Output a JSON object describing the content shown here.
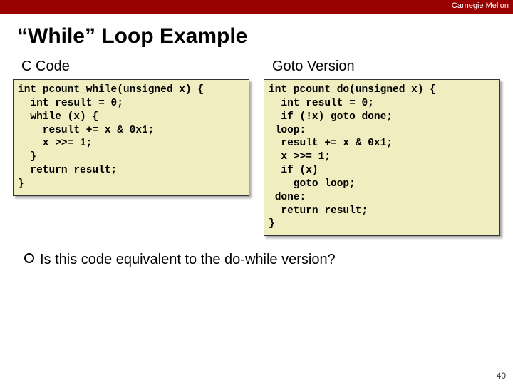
{
  "topbar": {
    "org": "Carnegie Mellon"
  },
  "title": "“While” Loop Example",
  "left": {
    "header": "C Code",
    "code": "int pcount_while(unsigned x) {\n  int result = 0;\n  while (x) {\n    result += x & 0x1;\n    x >>= 1;\n  }\n  return result;\n}"
  },
  "right": {
    "header": "Goto Version",
    "code": "int pcount_do(unsigned x) {\n  int result = 0;\n  if (!x) goto done;\n loop:\n  result += x & 0x1;\n  x >>= 1;\n  if (x)\n    goto loop;\n done:\n  return result;\n}"
  },
  "question": "Is this code equivalent to the do-while version?",
  "pagenum": "40"
}
